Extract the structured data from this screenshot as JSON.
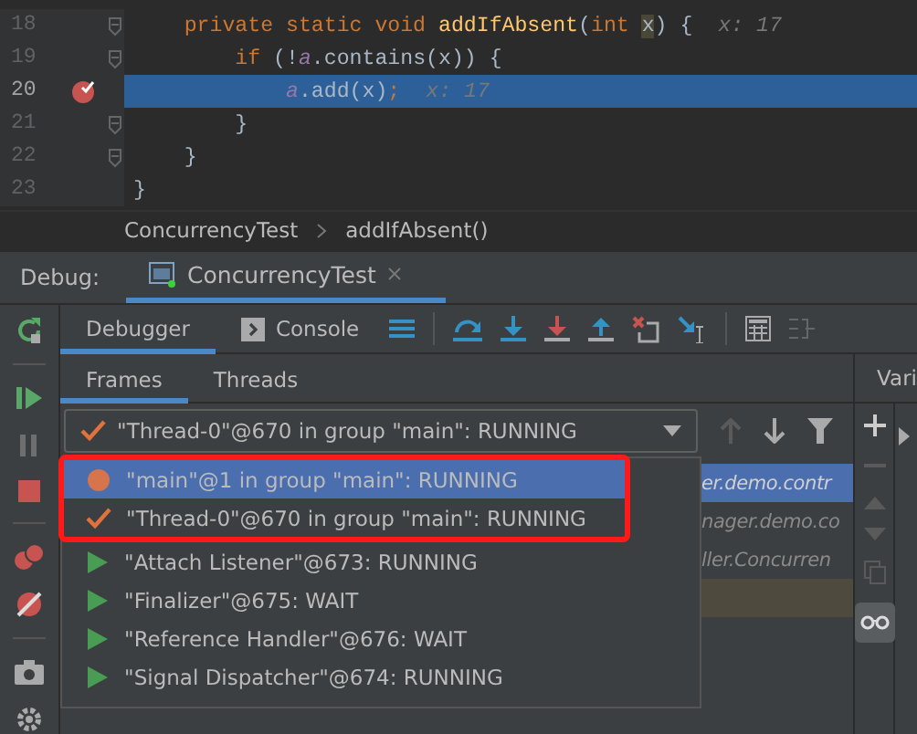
{
  "editor": {
    "lines": [
      {
        "number": "18",
        "fold": true,
        "breakpoint": false,
        "current": false,
        "tokens": [
          {
            "kind": "keyword",
            "text": "    private static void "
          },
          {
            "kind": "method",
            "text": "addIfAbsent"
          },
          {
            "kind": "plain",
            "text": "("
          },
          {
            "kind": "keyword",
            "text": "int "
          },
          {
            "kind": "usage",
            "text": "x"
          },
          {
            "kind": "plain",
            "text": ") {"
          },
          {
            "kind": "hint",
            "text": "x: 17"
          }
        ]
      },
      {
        "number": "19",
        "fold": true,
        "breakpoint": false,
        "current": false,
        "tokens": [
          {
            "kind": "keyword",
            "text": "        if "
          },
          {
            "kind": "plain",
            "text": "(!"
          },
          {
            "kind": "field",
            "text": "a"
          },
          {
            "kind": "plain",
            "text": ".contains(x)) {"
          }
        ]
      },
      {
        "number": "20",
        "fold": false,
        "breakpoint": true,
        "current": true,
        "tokens": [
          {
            "kind": "field",
            "text": "            a"
          },
          {
            "kind": "plain",
            "text": ".add(x)"
          },
          {
            "kind": "keyword",
            "text": ";"
          },
          {
            "kind": "hint",
            "text": "x: 17"
          }
        ]
      },
      {
        "number": "21",
        "fold": true,
        "breakpoint": false,
        "current": false,
        "tokens": [
          {
            "kind": "plain",
            "text": "        }"
          }
        ]
      },
      {
        "number": "22",
        "fold": true,
        "breakpoint": false,
        "current": false,
        "tokens": [
          {
            "kind": "plain",
            "text": "    }"
          }
        ]
      },
      {
        "number": "23",
        "fold": false,
        "breakpoint": false,
        "current": false,
        "tokens": [
          {
            "kind": "plain",
            "text": "}"
          }
        ]
      }
    ]
  },
  "breadcrumbs": [
    "ConcurrencyTest",
    "addIfAbsent()"
  ],
  "debug": {
    "label": "Debug:",
    "tabs": [
      {
        "label": "ConcurrencyTest",
        "selected": true
      }
    ]
  },
  "debugger_tabs": [
    {
      "label": "Debugger",
      "selected": true
    },
    {
      "label": "Console",
      "selected": false
    }
  ],
  "panel_tabs": [
    {
      "label": "Frames",
      "selected": true
    },
    {
      "label": "Threads",
      "selected": false
    }
  ],
  "variables_tab": "Vari",
  "thread_combo": {
    "kind": "current",
    "value": "\"Thread-0\"@670 in group \"main\": RUNNING"
  },
  "thread_list": [
    {
      "kind": "breakpoint",
      "label": "\"main\"@1 in group \"main\": RUNNING",
      "selected": true,
      "annotated": true
    },
    {
      "kind": "current",
      "label": "\"Thread-0\"@670 in group \"main\": RUNNING",
      "selected": false,
      "annotated": true
    },
    {
      "kind": "running",
      "label": "\"Attach Listener\"@673: RUNNING",
      "selected": false,
      "annotated": false
    },
    {
      "kind": "running",
      "label": "\"Finalizer\"@675: WAIT",
      "selected": false,
      "annotated": false
    },
    {
      "kind": "running",
      "label": "\"Reference Handler\"@676: WAIT",
      "selected": false,
      "annotated": false
    },
    {
      "kind": "running",
      "label": "\"Signal Dispatcher\"@674: RUNNING",
      "selected": false,
      "annotated": false
    }
  ],
  "frames_behind": [
    {
      "kind": "frame",
      "text": "er.demo.contr",
      "selected": true
    },
    {
      "kind": "frame",
      "text": "nager.demo.co",
      "selected": false
    },
    {
      "kind": "frame",
      "text": "ller.Concurren",
      "selected": false
    },
    {
      "kind": "marked"
    }
  ],
  "watch_toggle": {
    "on": true
  }
}
